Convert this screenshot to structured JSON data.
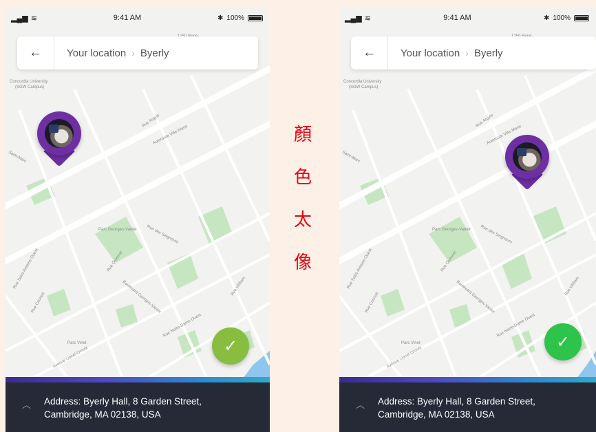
{
  "annotation": [
    "顏",
    "色",
    "太",
    "像"
  ],
  "phones": [
    {
      "status": {
        "time": "9:41 AM",
        "battery": "100%"
      },
      "search": {
        "crumb_from": "Your location",
        "crumb_to": "Byerly"
      },
      "confirm_color": "#88bd3f",
      "address": {
        "line1": "Address:  Byerly Hall, 8 Garden Street,",
        "line2": "Cambridge, MA 02138, USA"
      }
    },
    {
      "status": {
        "time": "9:41 AM",
        "battery": "100%"
      },
      "search": {
        "crumb_from": "Your location",
        "crumb_to": "Byerly"
      },
      "confirm_color": "#2ec34a",
      "address": {
        "line1": "Address:  Byerly Hall, 8 Garden Street,",
        "line2": "Cambridge, MA 02138, USA"
      }
    }
  ],
  "map_labels": {
    "university": "Concordia University",
    "campus": "(SGW Campus)",
    "rue_argyle": "Rue Argyle",
    "autoroute": "Autoroute Ville-Marie",
    "saint_marc": "Saint-Marc",
    "parc_georges": "Parc Georges-Vanier",
    "rue_seigneurs": "Rue des Seigneurs",
    "rue_quesnel": "Rue Quesnel",
    "rue_antoine": "Rue Saint-Antoine Ouest",
    "rue_coursol": "Rue Coursol",
    "boulevard": "Boulevard Georges-Vanier",
    "notre_dame": "Rue Notre-Dame Ouest",
    "rue_william": "Rue William",
    "lionel_groulx": "Avenue Lionel-Groulx",
    "parc_vinet": "Parc Vinet",
    "rene_levesque": "1250 René-"
  },
  "colors": {
    "map_bg": "#f2f2f0",
    "park": "#c6e6c2",
    "water": "#8fc6ee",
    "pin": "#6e2fa3",
    "panel": "#262a37"
  }
}
